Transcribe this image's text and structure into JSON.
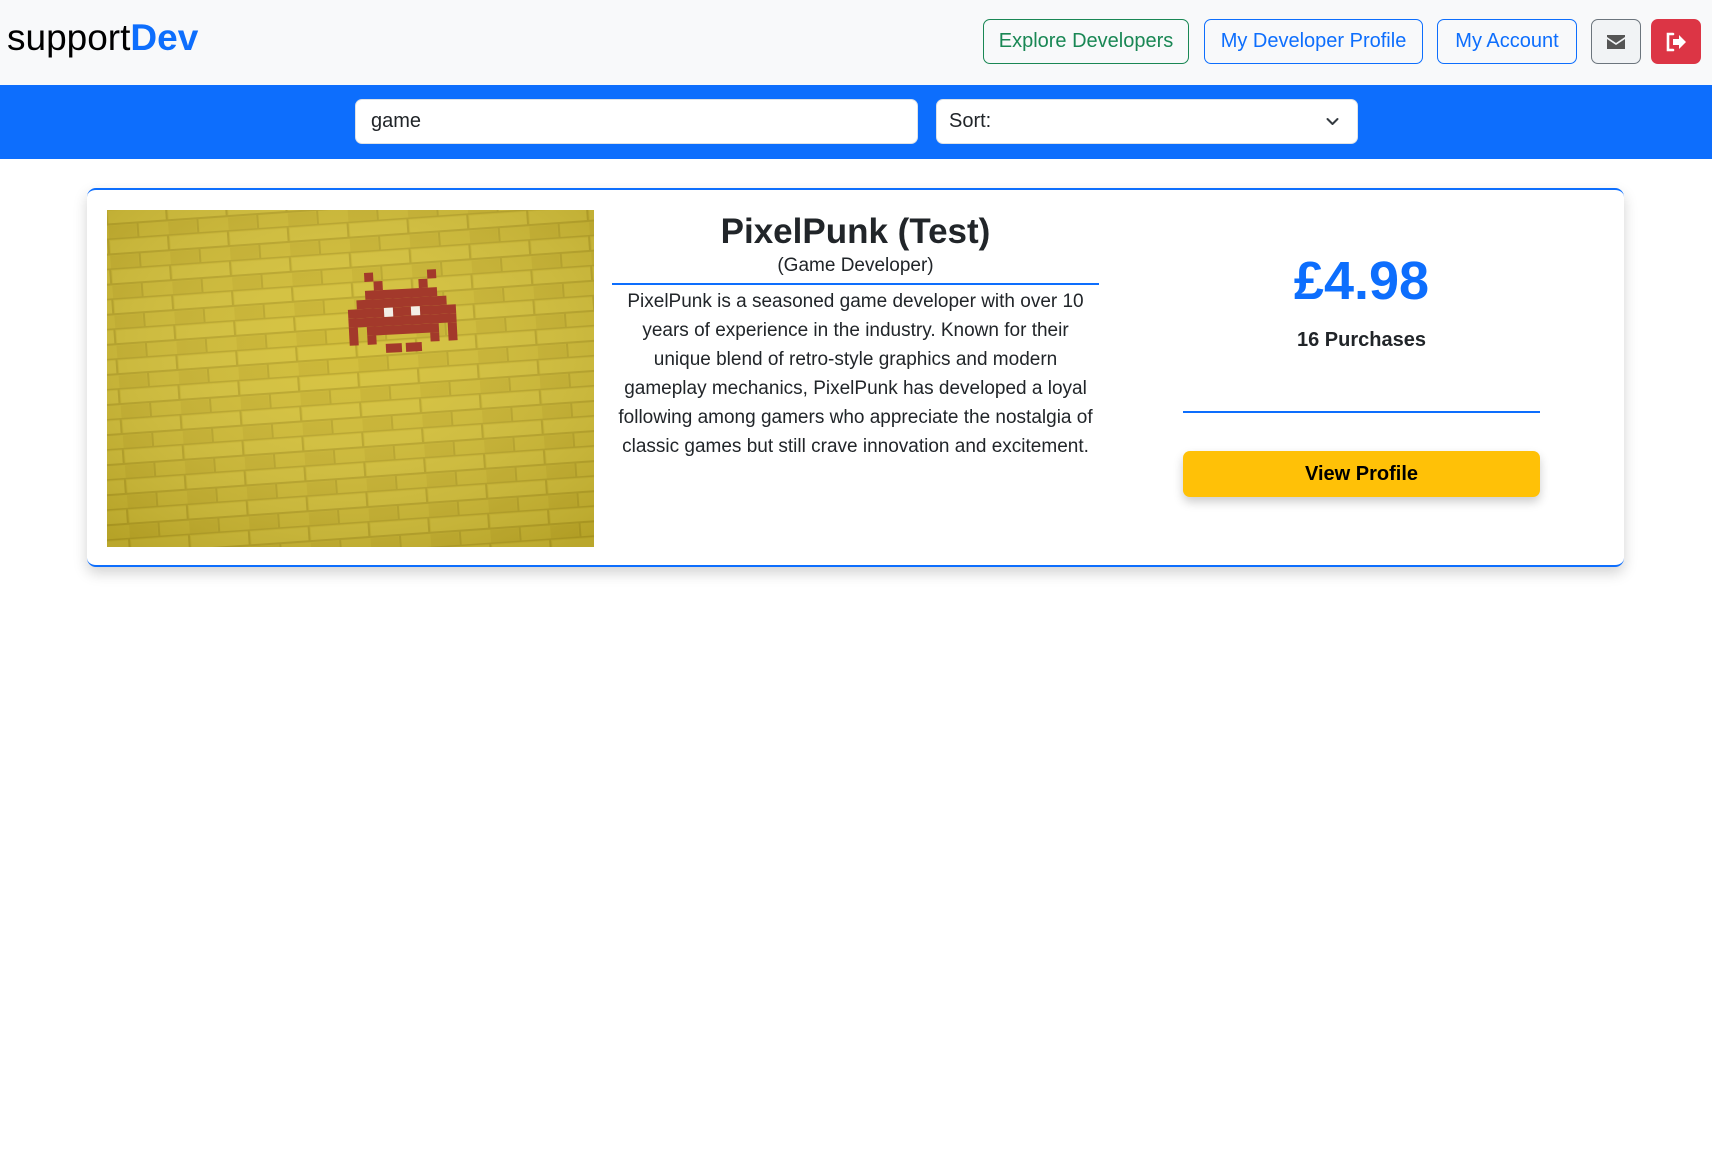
{
  "brand": {
    "prefix": "support",
    "accent": "Dev"
  },
  "nav": {
    "explore_label": "Explore Developers",
    "dev_profile_label": "My Developer Profile",
    "account_label": "My Account",
    "mail_icon": "envelope-icon",
    "logout_icon": "sign-out-icon"
  },
  "search": {
    "value": "game",
    "sort_label": "Sort:"
  },
  "results": [
    {
      "name": "PixelPunk (Test)",
      "role": "(Game Developer)",
      "description": "PixelPunk is a seasoned game developer with over 10 years of experience in the industry. Known for their unique blend of retro-style graphics and modern gameplay mechanics, PixelPunk has developed a loyal following among gamers who appreciate the nostalgia of classic games but still crave innovation and excitement.",
      "price": "£4.98",
      "purchases": "16 Purchases",
      "button_label": "View Profile"
    }
  ],
  "colors": {
    "primary": "#0d6efd",
    "success": "#198754",
    "danger": "#dc3545",
    "warning": "#ffc107",
    "brick_yellow": "#c9b52a",
    "invader_red": "#a0392a"
  }
}
